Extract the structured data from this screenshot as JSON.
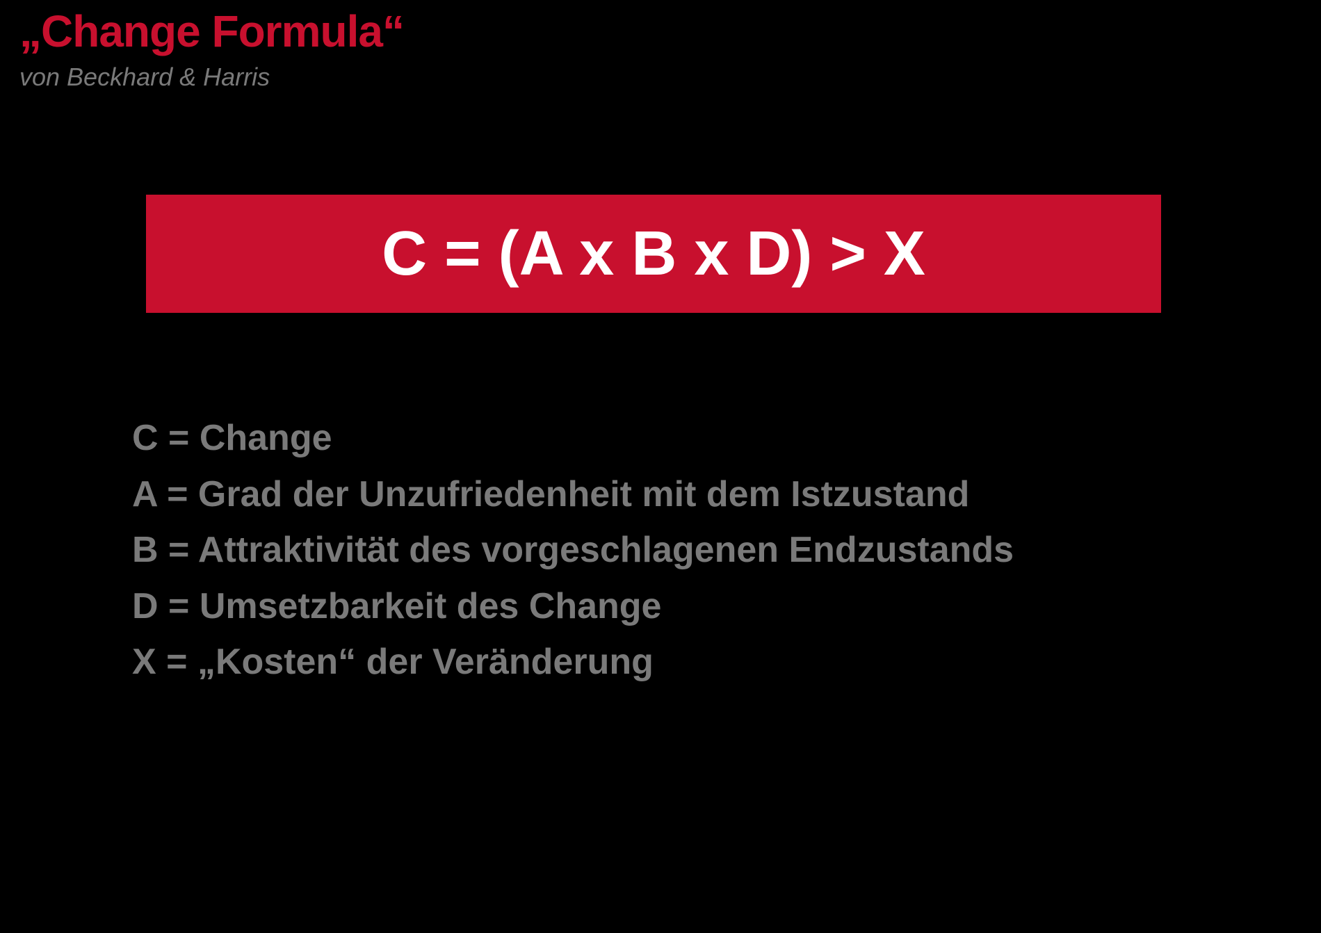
{
  "header": {
    "title": "„Change Formula“",
    "subtitle": "von Beckhard & Harris"
  },
  "formula": {
    "text": "C = (A x B x D) > X"
  },
  "legend": {
    "lines": [
      "C = Change",
      "A = Grad der Unzufriedenheit mit dem Istzustand",
      "B = Attraktivität des vorgeschlagenen Endzustands",
      "D = Umsetzbarkeit des Change",
      "X = „Kosten“ der Veränderung"
    ]
  }
}
